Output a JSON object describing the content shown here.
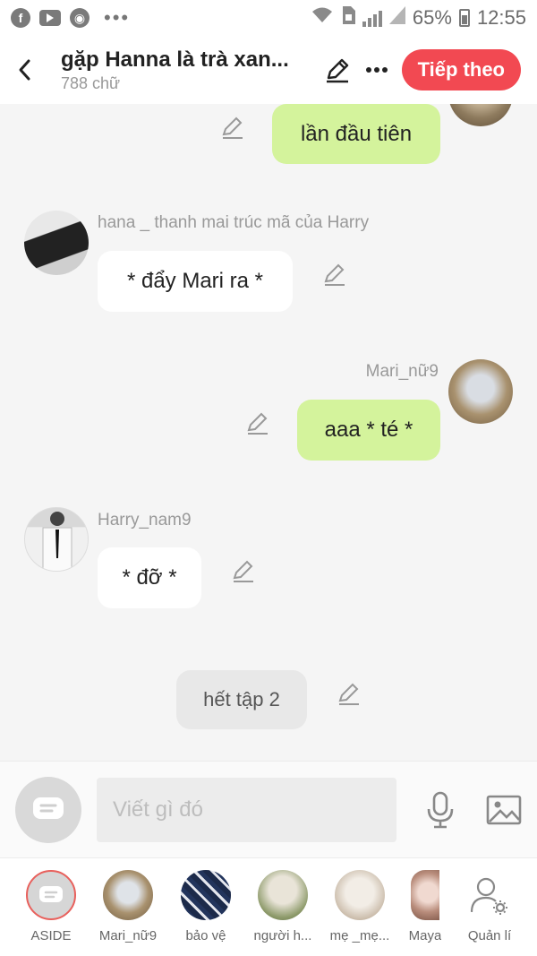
{
  "status_bar": {
    "battery": "65%",
    "time": "12:55",
    "left_icons": [
      "facebook-icon",
      "youtube-icon",
      "chrome-icon"
    ]
  },
  "header": {
    "title": "gặp Hanna là trà xan...",
    "word_count": "788 chữ",
    "next_label": "Tiếp theo"
  },
  "messages": [
    {
      "side": "right",
      "text": "lần đầu tiên"
    },
    {
      "side": "left",
      "sender": "hana _ thanh mai trúc mã của Harry",
      "text": "* đẩy Mari ra *"
    },
    {
      "side": "right",
      "sender": "Mari_nữ9",
      "text": "aaa * té *"
    },
    {
      "side": "left",
      "sender": "Harry_nam9",
      "text": "* đỡ *"
    },
    {
      "side": "center",
      "text": "hết tập 2"
    }
  ],
  "input": {
    "placeholder": "Viết gì đó"
  },
  "tabs": [
    {
      "label": "ASIDE"
    },
    {
      "label": "Mari_nữ9"
    },
    {
      "label": "bảo vệ"
    },
    {
      "label": "người h..."
    },
    {
      "label": "mẹ _mẹ..."
    },
    {
      "label": "Maya"
    },
    {
      "label": "Quản lí"
    }
  ],
  "colors": {
    "accent": "#f24952",
    "green_bubble": "#d4f39c",
    "background": "#f5f5f5"
  }
}
